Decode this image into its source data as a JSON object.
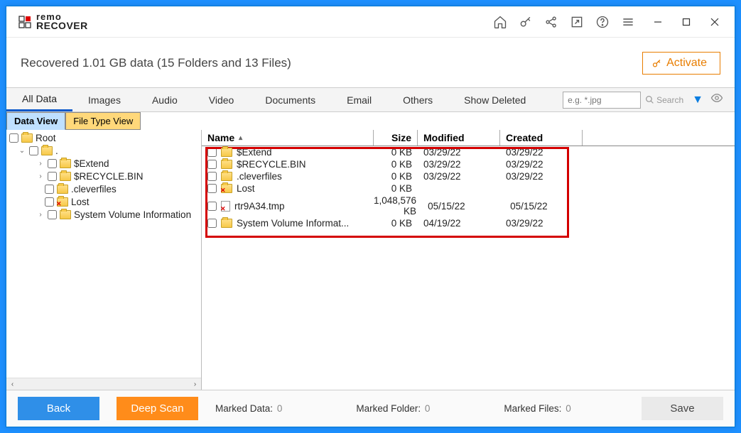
{
  "brand": {
    "name_line1": "remo",
    "name_line2": "RECOVER"
  },
  "summary": "Recovered 1.01 GB data (15 Folders and 13 Files)",
  "activate_label": "Activate",
  "filters": [
    "All Data",
    "Images",
    "Audio",
    "Video",
    "Documents",
    "Email",
    "Others",
    "Show Deleted"
  ],
  "search": {
    "placeholder": "e.g. *.jpg",
    "button": "Search"
  },
  "view_tabs": {
    "data": "Data View",
    "filetype": "File Type View"
  },
  "tree": [
    {
      "level": 0,
      "expand": "",
      "name": "Root",
      "icon": "folder"
    },
    {
      "level": 1,
      "expand": "v",
      "name": ".",
      "icon": "folder"
    },
    {
      "level": 2,
      "expand": ">",
      "name": "$Extend",
      "icon": "folder"
    },
    {
      "level": 2,
      "expand": ">",
      "name": "$RECYCLE.BIN",
      "icon": "folder"
    },
    {
      "level": 2,
      "expand": "",
      "name": ".cleverfiles",
      "icon": "folder"
    },
    {
      "level": 2,
      "expand": "",
      "name": "Lost",
      "icon": "folder-lost"
    },
    {
      "level": 2,
      "expand": ">",
      "name": "System Volume Information",
      "icon": "folder"
    }
  ],
  "columns": {
    "name": "Name",
    "size": "Size",
    "modified": "Modified",
    "created": "Created"
  },
  "rows": [
    {
      "name": "$Extend",
      "icon": "folder",
      "size": "0 KB",
      "modified": "03/29/22",
      "created": "03/29/22"
    },
    {
      "name": "$RECYCLE.BIN",
      "icon": "folder",
      "size": "0 KB",
      "modified": "03/29/22",
      "created": "03/29/22"
    },
    {
      "name": ".cleverfiles",
      "icon": "folder",
      "size": "0 KB",
      "modified": "03/29/22",
      "created": "03/29/22"
    },
    {
      "name": "Lost",
      "icon": "folder-lost",
      "size": "0 KB",
      "modified": "",
      "created": ""
    },
    {
      "name": "rtr9A34.tmp",
      "icon": "file-lost",
      "size": "1,048,576 KB",
      "modified": "05/15/22",
      "created": "05/15/22"
    },
    {
      "name": "System Volume Informat...",
      "icon": "folder",
      "size": "0 KB",
      "modified": "04/19/22",
      "created": "03/29/22"
    }
  ],
  "footer": {
    "back": "Back",
    "deep": "Deep Scan",
    "save": "Save",
    "marked_data_label": "Marked Data:",
    "marked_data_value": "0",
    "marked_folder_label": "Marked Folder:",
    "marked_folder_value": "0",
    "marked_files_label": "Marked Files:",
    "marked_files_value": "0"
  }
}
